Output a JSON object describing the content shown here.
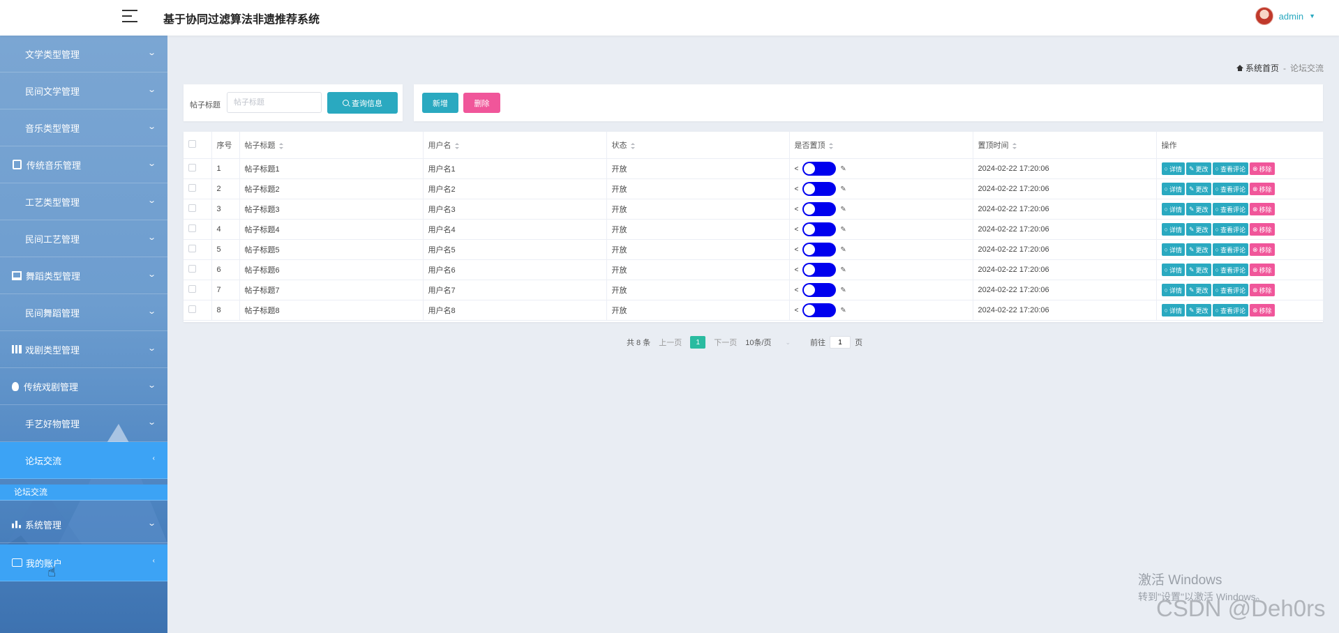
{
  "header": {
    "title": "基于协同过滤算法非遗推荐系统",
    "username": "admin"
  },
  "sidebar": {
    "items": [
      {
        "label": "文学类型管理",
        "icon": "grid-icon"
      },
      {
        "label": "民间文学管理",
        "icon": "grid-icon"
      },
      {
        "label": "音乐类型管理",
        "icon": "grid-icon"
      },
      {
        "label": "传统音乐管理",
        "icon": "clipboard-icon"
      },
      {
        "label": "工艺类型管理",
        "icon": "grid-icon"
      },
      {
        "label": "民间工艺管理",
        "icon": "grid-icon"
      },
      {
        "label": "舞蹈类型管理",
        "icon": "monitor-icon"
      },
      {
        "label": "民间舞蹈管理",
        "icon": "grid-icon"
      },
      {
        "label": "戏剧类型管理",
        "icon": "books-icon"
      },
      {
        "label": "传统戏剧管理",
        "icon": "bulb-icon"
      },
      {
        "label": "手艺好物管理",
        "icon": "grid-icon"
      },
      {
        "label": "论坛交流",
        "icon": "grid-icon",
        "active": true
      }
    ],
    "submenu_label": "论坛交流",
    "bottom_items": [
      {
        "label": "系统管理",
        "icon": "bar-chart-icon"
      },
      {
        "label": "我的账户",
        "icon": "wallet-icon"
      }
    ]
  },
  "breadcrumb": {
    "home": "系统首页",
    "separator": "-",
    "current": "论坛交流"
  },
  "search": {
    "label": "帖子标题",
    "placeholder": "帖子标题",
    "button": "查询信息"
  },
  "actions": {
    "add": "新增",
    "delete": "删除"
  },
  "table": {
    "columns": [
      "序号",
      "帖子标题",
      "用户名",
      "状态",
      "是否置顶",
      "置顶时间",
      "操作"
    ],
    "rows": [
      {
        "no": "1",
        "title": "帖子标题1",
        "user": "用户名1",
        "status": "开放",
        "time": "2024-02-22 17:20:06"
      },
      {
        "no": "2",
        "title": "帖子标题2",
        "user": "用户名2",
        "status": "开放",
        "time": "2024-02-22 17:20:06"
      },
      {
        "no": "3",
        "title": "帖子标题3",
        "user": "用户名3",
        "status": "开放",
        "time": "2024-02-22 17:20:06"
      },
      {
        "no": "4",
        "title": "帖子标题4",
        "user": "用户名4",
        "status": "开放",
        "time": "2024-02-22 17:20:06"
      },
      {
        "no": "5",
        "title": "帖子标题5",
        "user": "用户名5",
        "status": "开放",
        "time": "2024-02-22 17:20:06"
      },
      {
        "no": "6",
        "title": "帖子标题6",
        "user": "用户名6",
        "status": "开放",
        "time": "2024-02-22 17:20:06"
      },
      {
        "no": "7",
        "title": "帖子标题7",
        "user": "用户名7",
        "status": "开放",
        "time": "2024-02-22 17:20:06"
      },
      {
        "no": "8",
        "title": "帖子标题8",
        "user": "用户名8",
        "status": "开放",
        "time": "2024-02-22 17:20:06"
      }
    ],
    "ops": {
      "detail": "详情",
      "edit": "更改",
      "comments": "查看评论",
      "remove": "移除"
    }
  },
  "pagination": {
    "total": "共 8 条",
    "prev": "上一页",
    "current_page": "1",
    "next": "下一页",
    "page_size": "10条/页",
    "goto_prefix": "前往",
    "goto_value": "1",
    "goto_suffix": "页"
  },
  "watermarks": {
    "windows_line1": "激活 Windows",
    "windows_line2": "转到\"设置\"以激活 Windows。",
    "csdn": "CSDN @Deh0rs"
  },
  "colors": {
    "accent": "#2aa9c0",
    "danger": "#f0569a",
    "active_menu": "#3ca3f5",
    "toggle": "#0000ee",
    "current_page": "#2abba0"
  }
}
